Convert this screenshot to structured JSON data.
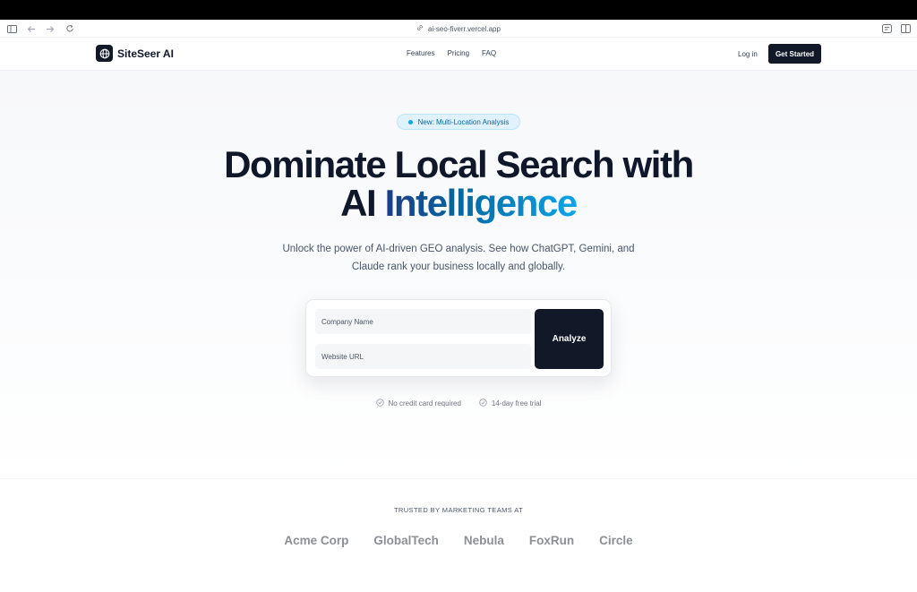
{
  "browser": {
    "url": "ai-seo-fiverr.vercel.app",
    "icons": [
      "sidebar-icon",
      "back-arrow-icon",
      "forward-arrow-icon",
      "reload-icon",
      "lock-icon",
      "reader-icon",
      "tabs-icon"
    ]
  },
  "nav": {
    "brand": "SiteSeer AI",
    "links": [
      "Features",
      "Pricing",
      "FAQ"
    ],
    "login": "Log in",
    "cta": "Get Started"
  },
  "hero": {
    "badge": "New: Multi-Location Analysis",
    "headline_line1": "Dominate Local Search with",
    "headline_ai": "AI",
    "headline_highlight": "Intelligence",
    "subtitle": "Unlock the power of AI-driven GEO analysis. See how ChatGPT, Gemini, and Claude rank your business locally and globally."
  },
  "form": {
    "company_placeholder": "Company Name",
    "website_placeholder": "Website URL",
    "company_value": "",
    "website_value": "",
    "submit": "Analyze"
  },
  "perks": [
    "No credit card required",
    "14-day free trial"
  ],
  "trusted": {
    "title": "TRUSTED BY MARKETING TEAMS AT",
    "logos": [
      "Acme Corp",
      "GlobalTech",
      "Nebula",
      "FoxRun",
      "Circle"
    ]
  },
  "colors": {
    "brand_dark": "#111827",
    "accent_start": "#1e3a8a",
    "accent_end": "#0ea5e9",
    "badge_bg": "#e0f2fe"
  }
}
